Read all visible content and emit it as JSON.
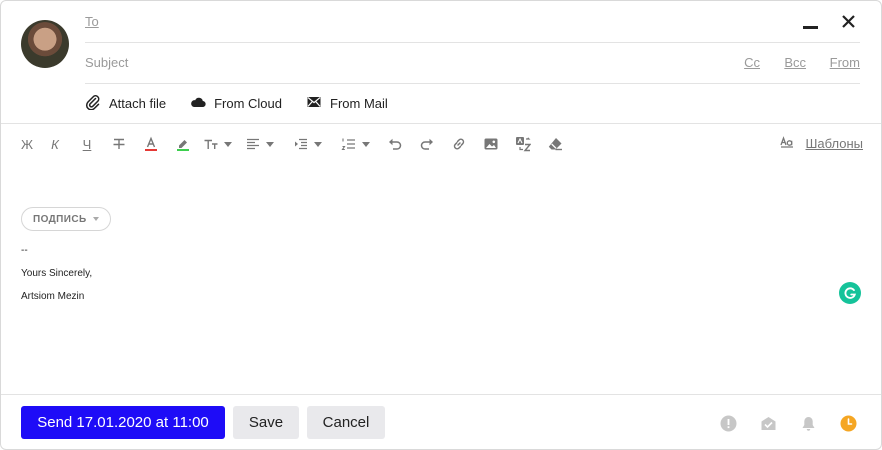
{
  "compose": {
    "to_label": "To",
    "subject_placeholder": "Subject",
    "cc_label": "Cc",
    "bcc_label": "Bcc",
    "from_label": "From"
  },
  "attach": {
    "attach_file": "Attach file",
    "from_cloud": "From Cloud",
    "from_mail": "From Mail"
  },
  "toolbar": {
    "bold": "Ж",
    "italic": "К",
    "underline": "Ч",
    "templates": "Шаблоны"
  },
  "signature": {
    "pill_label": "ПОДПИСЬ",
    "lines": [
      "--",
      "Yours Sincerely,",
      "Artsiom Mezin"
    ]
  },
  "footer": {
    "send_label": "Send 17.01.2020 at 11:00",
    "save_label": "Save",
    "cancel_label": "Cancel"
  },
  "colors": {
    "send": "#1e0cf7",
    "grammarly": "#15c39a",
    "scheduled": "#f5a623",
    "text_color_bar": "#e53935",
    "highlight_bar": "#3ccf4e"
  },
  "icons": {
    "window": [
      "minimize-icon",
      "close-icon"
    ],
    "attach": [
      "paperclip-icon",
      "cloud-icon",
      "mail-icon"
    ],
    "footer": [
      "important-icon",
      "read-receipt-icon",
      "notify-icon",
      "schedule-icon"
    ]
  }
}
